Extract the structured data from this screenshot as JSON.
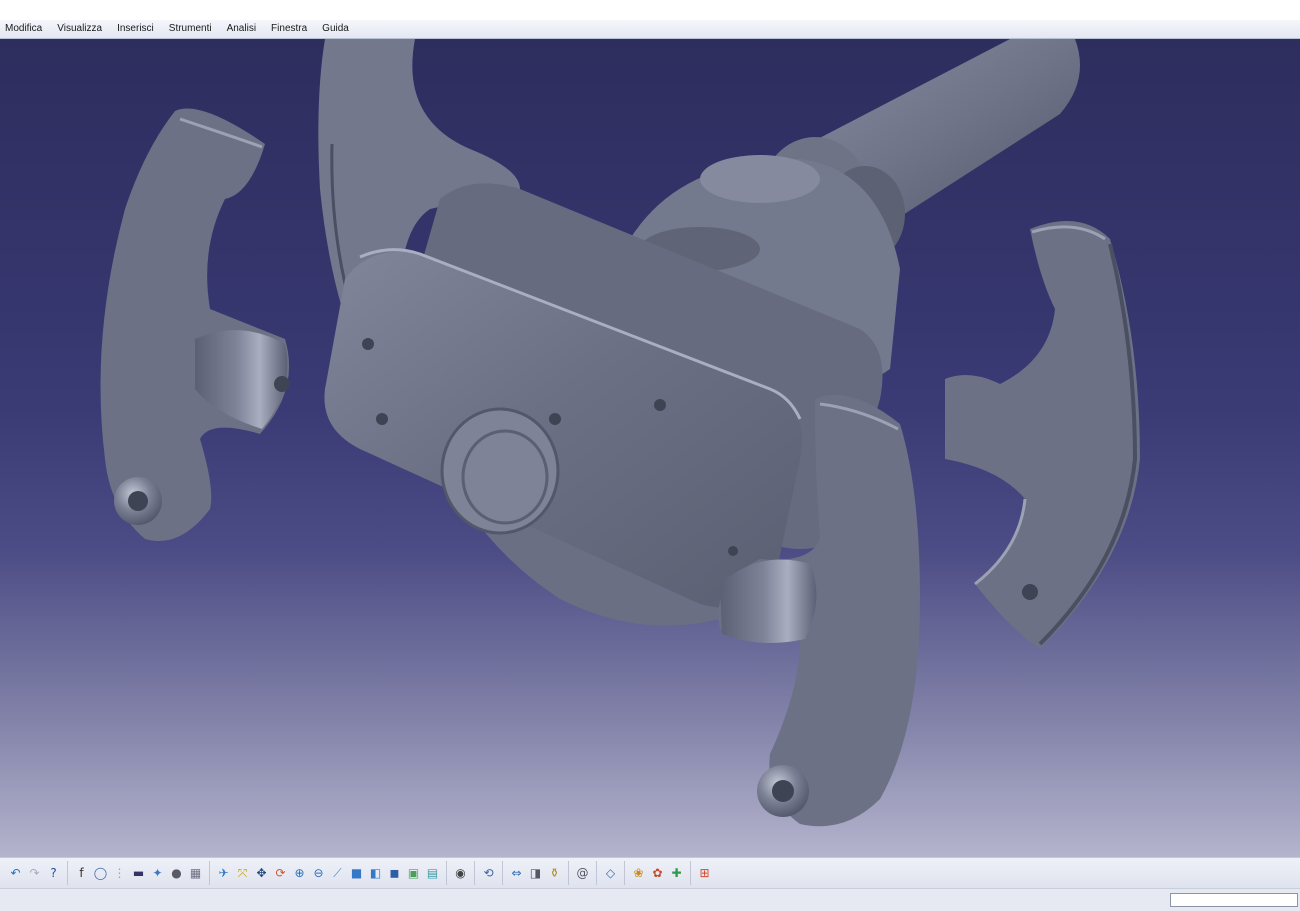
{
  "menu": {
    "items": [
      "Modifica",
      "Visualizza",
      "Inserisci",
      "Strumenti",
      "Analisi",
      "Finestra",
      "Guida"
    ]
  },
  "toolbar": {
    "groups": [
      [
        {
          "name": "undo-icon",
          "glyph": "↶",
          "color": "#2a6fb8"
        },
        {
          "name": "redo-icon",
          "glyph": "↷",
          "color": "#a7acb9"
        },
        {
          "name": "whats-this-help-icon",
          "glyph": "?",
          "color": "#1f4e9c"
        }
      ],
      [
        {
          "name": "formula-icon",
          "glyph": "f",
          "color": "#333333"
        },
        {
          "name": "comment-balloon-icon",
          "glyph": "◯",
          "color": "#3a6ab0"
        },
        {
          "name": "separator-handle-icon",
          "glyph": "⋮",
          "color": "#9aa0b0"
        },
        {
          "name": "layer-filter-icon",
          "glyph": "▬",
          "color": "#333366"
        },
        {
          "name": "tree-expand-icon",
          "glyph": "✦",
          "color": "#3d78c2"
        },
        {
          "name": "part-body-icon",
          "glyph": "●",
          "color": "#5a5a66"
        },
        {
          "name": "assembly-structure-icon",
          "glyph": "▦",
          "color": "#6b7080"
        }
      ],
      [
        {
          "name": "fly-mode-icon",
          "glyph": "✈",
          "color": "#2f7bc4"
        },
        {
          "name": "fit-all-icon",
          "glyph": "⤧",
          "color": "#c9a012"
        },
        {
          "name": "pan-icon",
          "glyph": "✥",
          "color": "#23467d"
        },
        {
          "name": "rotate-icon",
          "glyph": "⟳",
          "color": "#d4552b"
        },
        {
          "name": "zoom-in-icon",
          "glyph": "⊕",
          "color": "#2a6fb8"
        },
        {
          "name": "zoom-out-icon",
          "glyph": "⊖",
          "color": "#2a6fb8"
        },
        {
          "name": "normal-view-icon",
          "glyph": "⟋",
          "color": "#3b8ed6"
        },
        {
          "name": "multi-view-icon",
          "glyph": "■",
          "color": "#3578c8"
        },
        {
          "name": "isometric-view-icon",
          "glyph": "◧",
          "color": "#3578c8"
        },
        {
          "name": "render-style-icon",
          "glyph": "◼",
          "color": "#2d5fa8"
        },
        {
          "name": "hide-show-icon",
          "glyph": "▣",
          "color": "#4aa056"
        },
        {
          "name": "swap-visible-space-icon",
          "glyph": "▤",
          "color": "#3e9aa8"
        }
      ],
      [
        {
          "name": "capture-camera-icon",
          "glyph": "◉",
          "color": "#444444"
        }
      ],
      [
        {
          "name": "update-icon",
          "glyph": "⟲",
          "color": "#3a66a8"
        }
      ],
      [
        {
          "name": "measure-between-icon",
          "glyph": "⇔",
          "color": "#2a6fb8"
        },
        {
          "name": "measure-item-icon",
          "glyph": "◨",
          "color": "#555566"
        },
        {
          "name": "measure-inertia-icon",
          "glyph": "⚱",
          "color": "#b08a1c"
        }
      ],
      [
        {
          "name": "constraint-icon",
          "glyph": "@",
          "color": "#555566"
        }
      ],
      [
        {
          "name": "sketch-plane-icon",
          "glyph": "◇",
          "color": "#2a6fb8"
        }
      ],
      [
        {
          "name": "apply-material-icon",
          "glyph": "❀",
          "color": "#c98a1a"
        },
        {
          "name": "catalog-browser-icon",
          "glyph": "✿",
          "color": "#c94a2a"
        },
        {
          "name": "knowledge-icon",
          "glyph": "✚",
          "color": "#2f9a4a"
        }
      ],
      [
        {
          "name": "grid-snap-icon",
          "glyph": "⊞",
          "color": "#d44a2a"
        }
      ]
    ]
  },
  "status": {
    "command_value": ""
  },
  "colors": {
    "part_fill": "#6b7184",
    "viewport_top": "#2d2d5e",
    "viewport_bottom": "#b4b4cd"
  }
}
